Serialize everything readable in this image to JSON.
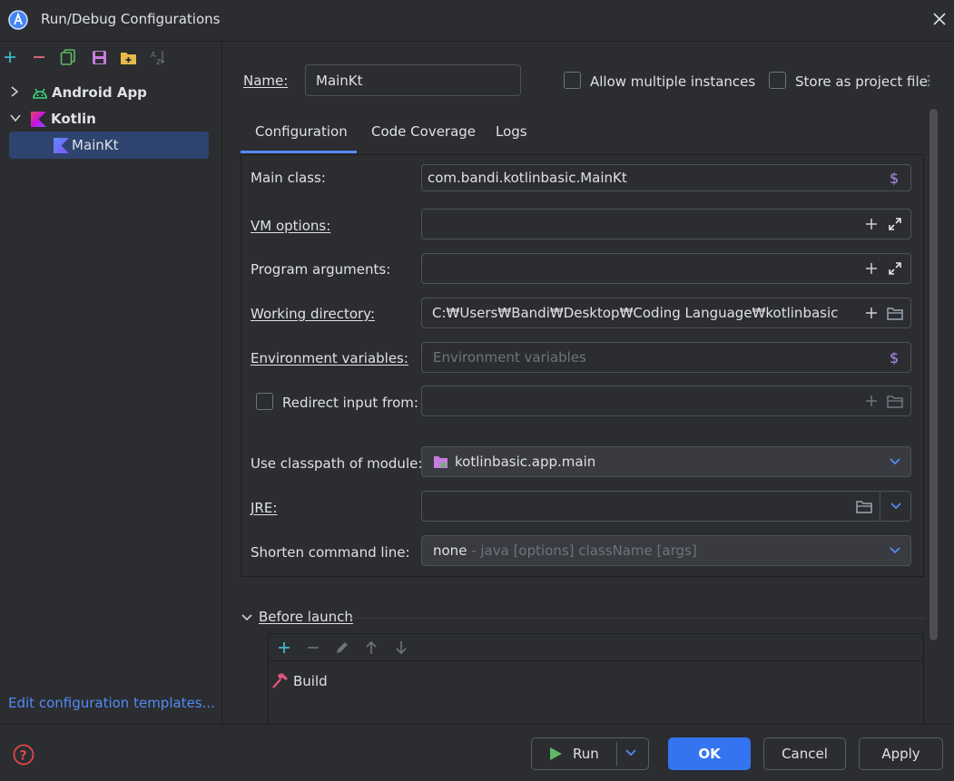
{
  "window": {
    "title": "Run/Debug Configurations"
  },
  "sidebar": {
    "tree": [
      {
        "label": "Android App",
        "expanded": false
      },
      {
        "label": "Kotlin",
        "expanded": true
      },
      {
        "label": "MainKt",
        "selected": true
      }
    ],
    "edit_templates": "Edit configuration templates..."
  },
  "form": {
    "name_label": "Name:",
    "name_value": "MainKt",
    "allow_multiple": "Allow multiple instances",
    "store_project": "Store as project file",
    "tabs": [
      "Configuration",
      "Code Coverage",
      "Logs"
    ],
    "main_class_label": "Main class:",
    "main_class_value": "com.bandi.kotlinbasic.MainKt",
    "vm_options_label": "VM options:",
    "program_args_label": "Program arguments:",
    "working_dir_label": "Working directory:",
    "working_dir_value": "C:₩Users₩Bandi₩Desktop₩Coding Language₩kotlinbasic",
    "env_vars_label": "Environment variables:",
    "env_vars_placeholder": "Environment variables",
    "redirect_label": "Redirect input from:",
    "classpath_label": "Use classpath of module:",
    "classpath_value": "kotlinbasic.app.main",
    "jre_label": "JRE:",
    "shorten_label": "Shorten command line:",
    "shorten_value": "none",
    "shorten_hint": " - java [options] className [args]",
    "before_launch": "Before launch",
    "build_task": "Build"
  },
  "footer": {
    "run": "Run",
    "ok": "OK",
    "cancel": "Cancel",
    "apply": "Apply"
  },
  "colors": {
    "accent": "#3574f0",
    "link": "#548af7",
    "selection": "#2e436e",
    "kotlin": "#7f52ff",
    "android": "#3ddc84"
  }
}
